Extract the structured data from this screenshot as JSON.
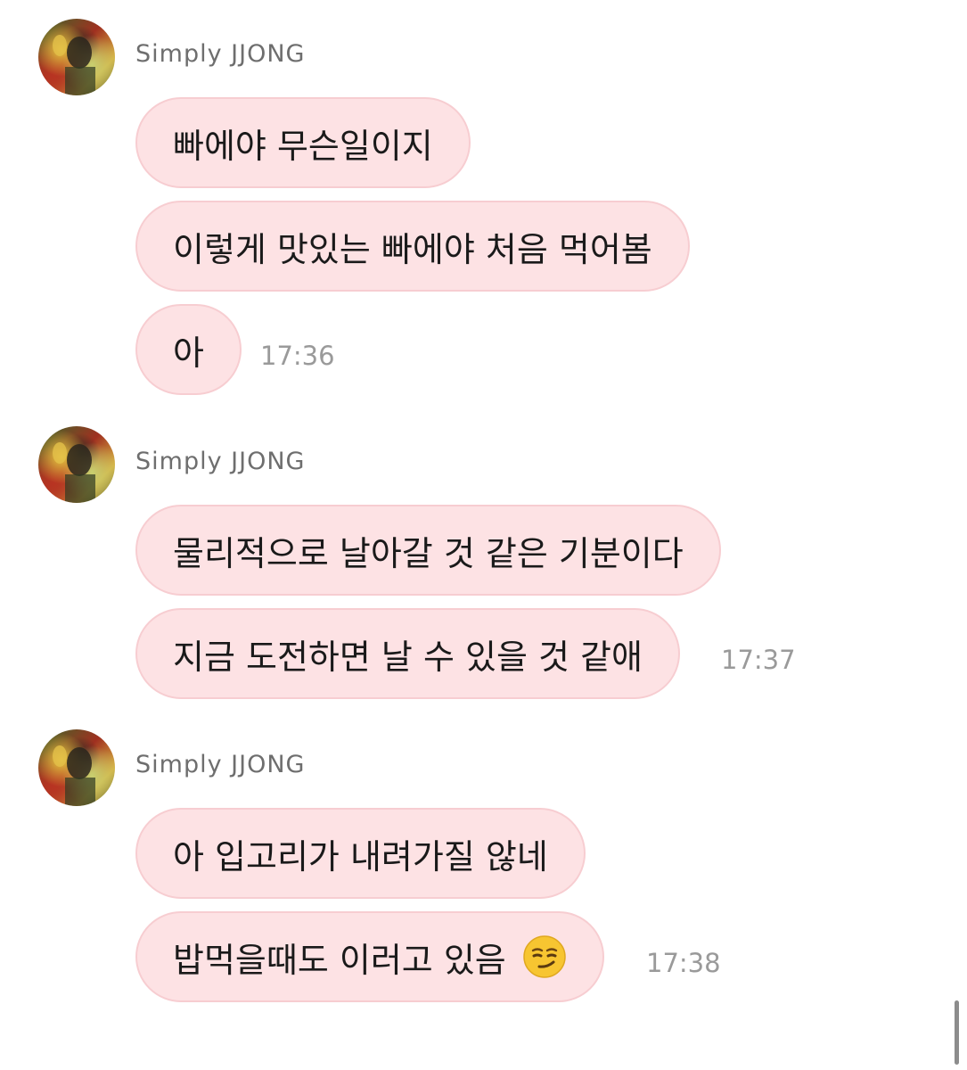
{
  "groups": [
    {
      "sender": "Simply JJONG",
      "messages": [
        "빠에야 무슨일이지",
        "이렇게 맛있는 빠에야 처음 먹어봄",
        "아"
      ],
      "time": "17:36"
    },
    {
      "sender": "Simply JJONG",
      "messages": [
        "물리적으로 날아갈 것 같은 기분이다",
        "지금 도전하면 날 수 있을 것 같애"
      ],
      "time": "17:37"
    },
    {
      "sender": "Simply JJONG",
      "messages": [
        "아 입고리가 내려가질 않네",
        "밥먹을때도 이러고 있음"
      ],
      "time": "17:38",
      "last_message_emoji": "smirking-face-emoji"
    }
  ],
  "colors": {
    "bubble_fill": "#fde2e4",
    "bubble_border": "#f7cdd1",
    "sender_text": "#6e6e6e",
    "time_text": "#9a9a9a"
  }
}
